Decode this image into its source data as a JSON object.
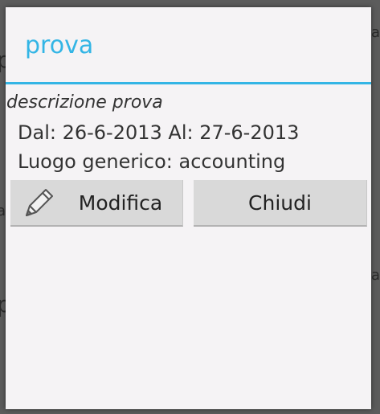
{
  "background": {
    "fragments": [
      "p",
      "a",
      "p",
      "p",
      "a"
    ]
  },
  "dialog": {
    "title": "prova",
    "description": "descrizione prova",
    "dates": "Dal: 26-6-2013 Al: 27-6-2013",
    "location": "Luogo generico: accounting",
    "buttons": {
      "edit_label": "Modifica",
      "edit_icon": "pencil-icon",
      "close_label": "Chiudi"
    }
  },
  "colors": {
    "accent": "#33b5e5",
    "dialog_bg": "#f5f3f5",
    "button_bg": "#d9d9d9"
  }
}
